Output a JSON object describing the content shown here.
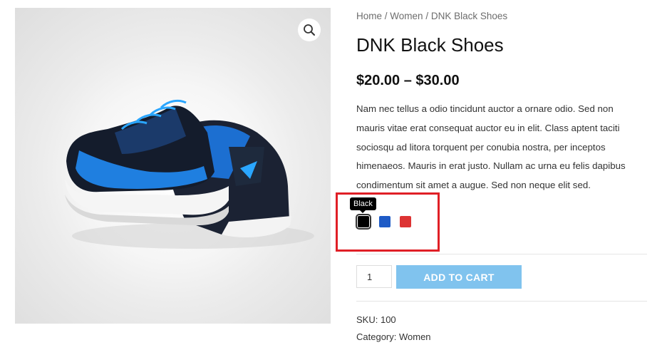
{
  "breadcrumb": {
    "home": "Home",
    "sep1": " / ",
    "category": "Women",
    "sep2": " / ",
    "current": "DNK Black Shoes"
  },
  "product": {
    "title": "DNK Black Shoes",
    "price": "$20.00 – $30.00",
    "description": "Nam nec tellus a odio tincidunt auctor a ornare odio. Sed non mauris vitae erat consequat auctor eu in elit. Class aptent taciti sociosqu ad litora torquent per conubia nostra, per inceptos himenaeos. Mauris in erat justo. Nullam ac urna eu felis dapibus condimentum sit amet a augue. Sed non neque elit sed."
  },
  "swatches": {
    "tooltip": "Black",
    "items": [
      {
        "name": "Black",
        "color": "#000000",
        "selected": true
      },
      {
        "name": "Blue",
        "color": "#1e5bc6",
        "selected": false
      },
      {
        "name": "Red",
        "color": "#dd3333",
        "selected": false
      }
    ]
  },
  "cart": {
    "quantity": "1",
    "button_label": "ADD TO CART"
  },
  "meta": {
    "sku_label": "SKU: ",
    "sku_value": "100",
    "category_label": "Category: ",
    "category_value": "Women"
  },
  "icons": {
    "zoom": "search-icon"
  },
  "colors": {
    "accent_button": "#80c3ee",
    "highlight": "#e01f26"
  }
}
